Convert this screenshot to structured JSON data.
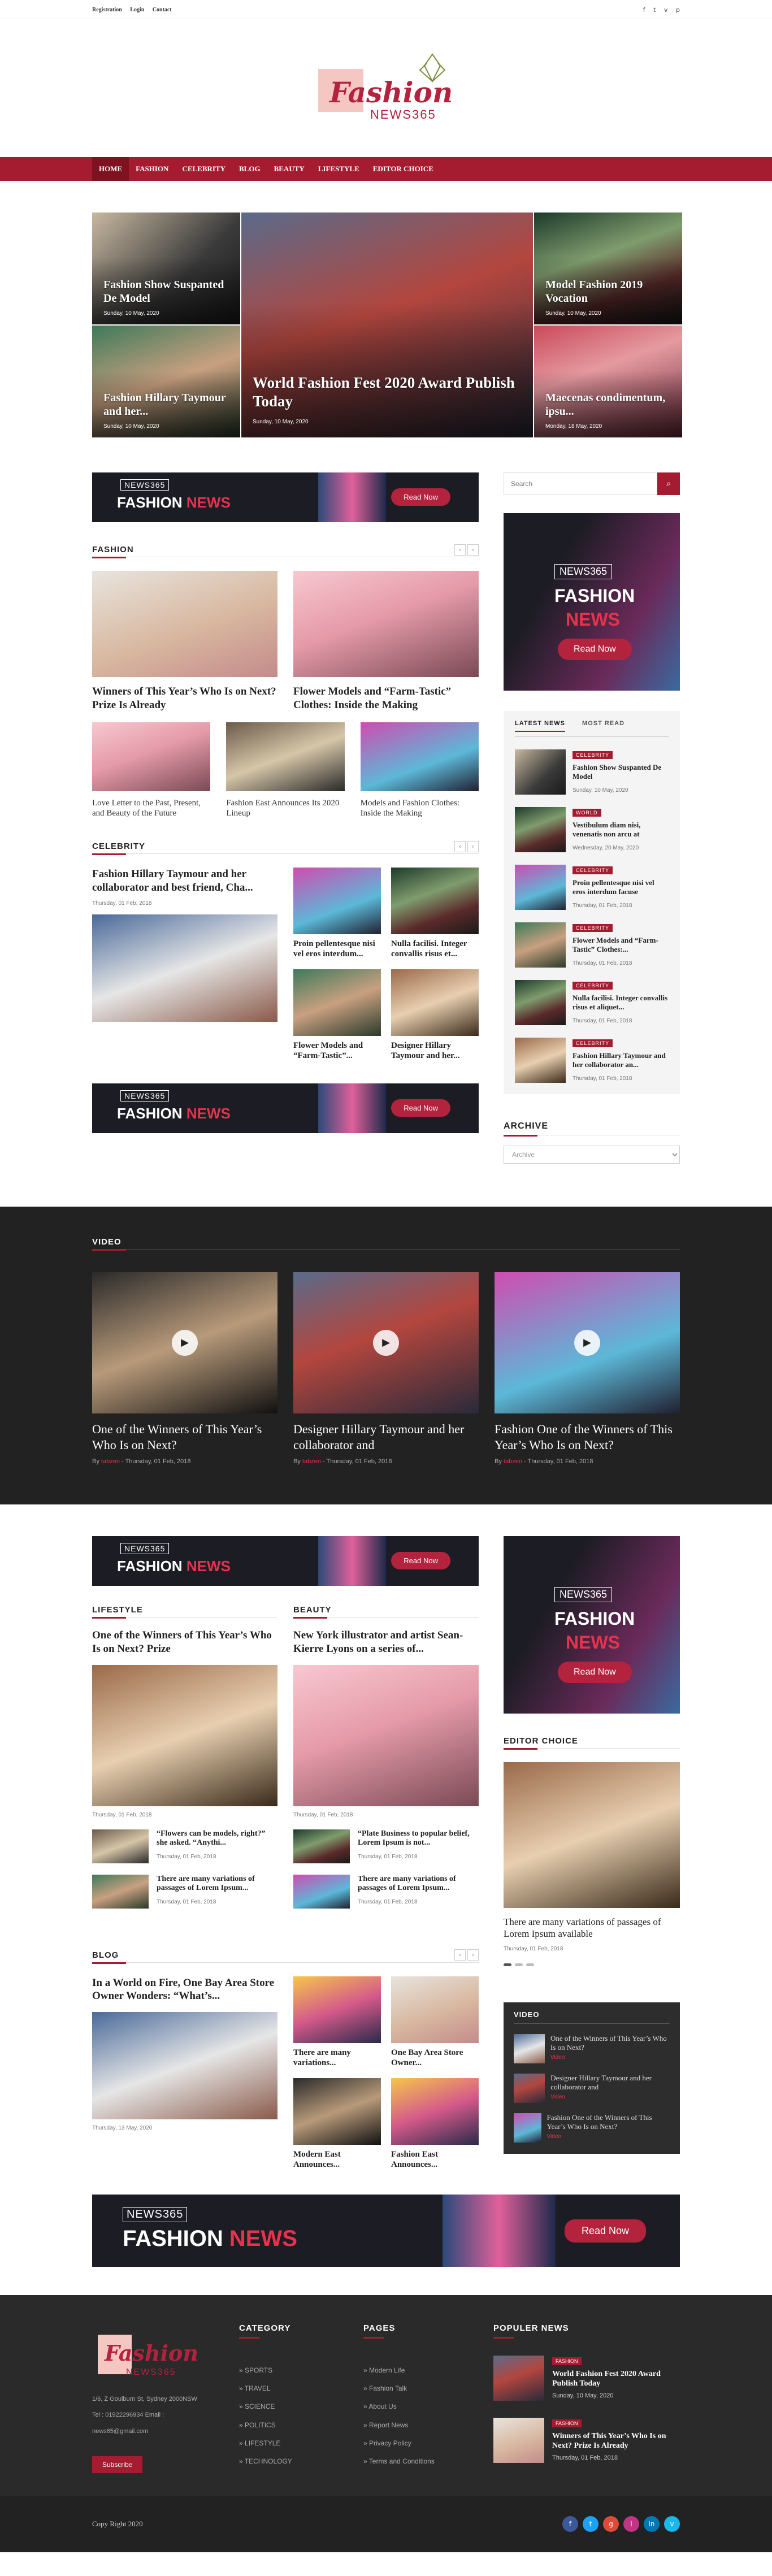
{
  "topbar": {
    "links": [
      "Registration",
      "Login",
      "Contact"
    ],
    "icons": [
      "f",
      "t",
      "v",
      "p"
    ]
  },
  "logo": {
    "word": "Fashion",
    "sub": "NEWS365"
  },
  "nav": [
    "HOME",
    "FASHION",
    "CELEBRITY",
    "BLOG",
    "BEAUTY",
    "LIFESTYLE",
    "EDITOR CHOICE"
  ],
  "hero": [
    {
      "title": "Fashion Show Suspanted De Model",
      "date": "Sunday, 10 May, 2020"
    },
    {
      "title": "World Fashion Fest 2020 Award Publish Today",
      "date": "Sunday, 10 May, 2020"
    },
    {
      "title": "Model Fashion 2019 Vocation",
      "date": "Sunday, 10 May, 2020"
    },
    {
      "title": "Fashion Hillary Taymour and her...",
      "date": "Sunday, 10 May, 2020"
    },
    {
      "title": "Maecenas condimentum, ipsu...",
      "date": "Monday, 18 May, 2020"
    }
  ],
  "banner": {
    "nb": "NEWS365",
    "fn1": "FASHION",
    "fn2": "NEWS",
    "btn": "Read Now"
  },
  "fashion": {
    "title": "FASHION",
    "main": [
      {
        "title": "Winners of This Year’s Who Is on Next? Prize Is Already"
      },
      {
        "title": "Flower Models and “Farm-Tastic” Clothes: Inside the Making"
      }
    ],
    "small": [
      {
        "title": "Love Letter to the Past, Present, and Beauty of the Future"
      },
      {
        "title": "Fashion East Announces Its 2020 Lineup"
      },
      {
        "title": "Models and Fashion Clothes: Inside the Making"
      }
    ]
  },
  "celebrity": {
    "title": "CELEBRITY",
    "main": {
      "title": "Fashion Hillary Taymour and her collaborator and best friend, Cha...",
      "date": "Thursday, 01 Feb, 2018"
    },
    "mini": [
      {
        "title": "Proin pellentesque nisi vel eros interdum..."
      },
      {
        "title": "Nulla facilisi. Integer convallis risus et..."
      },
      {
        "title": "Flower Models and “Farm-Tastic”..."
      },
      {
        "title": "Designer Hillary Taymour and her..."
      }
    ]
  },
  "sidebar": {
    "search_placeholder": "Search",
    "ad": {
      "nb": "NEWS365",
      "fn1": "FASHION",
      "fn2": "NEWS",
      "btn": "Read Now"
    },
    "tabs": [
      "LATEST NEWS",
      "MOST READ"
    ],
    "latest": [
      {
        "tag": "CELEBRITY",
        "title": "Fashion Show Suspanted De Model",
        "date": "Sunday, 10 May, 2020"
      },
      {
        "tag": "WORLD",
        "title": "Vestibulum diam nisi, venenatis non arcu at",
        "date": "Wednesday, 20 May, 2020"
      },
      {
        "tag": "CELEBRITY",
        "title": "Proin pellentesque nisi vel eros interdum facuse",
        "date": "Thursday, 01 Feb, 2018"
      },
      {
        "tag": "CELEBRITY",
        "title": "Flower Models and “Farm-Tastic” Clothes:...",
        "date": "Thursday, 01 Feb, 2018"
      },
      {
        "tag": "CELEBRITY",
        "title": "Nulla facilisi. Integer convallis risus et aliquet...",
        "date": "Thursday, 01 Feb, 2018"
      },
      {
        "tag": "CELEBRITY",
        "title": "Fashion Hillary Taymour and her collaborator an...",
        "date": "Thursday, 01 Feb, 2018"
      }
    ],
    "archive_title": "ARCHIVE",
    "archive_select": "Archive"
  },
  "video": {
    "title": "VIDEO",
    "items": [
      {
        "title": "One of the Winners of This Year’s Who Is on Next?",
        "by": "By",
        "author": "tabzen",
        "date": "- Thursday, 01 Feb, 2018"
      },
      {
        "title": "Designer Hillary Taymour and her collaborator and",
        "by": "By",
        "author": "tabzen",
        "date": "- Thursday, 01 Feb, 2018"
      },
      {
        "title": "Fashion One of the Winners of This Year’s Who Is on Next?",
        "by": "By",
        "author": "tabzen",
        "date": "- Thursday, 01 Feb, 2018"
      }
    ]
  },
  "lifestyle": {
    "title": "LIFESTYLE",
    "main": {
      "title": "One of the Winners of This Year’s Who Is on Next? Prize",
      "date": "Thursday, 01 Feb, 2018"
    },
    "items": [
      {
        "title": "“Flowers can be models, right?” she asked. “Anythi...",
        "date": "Thursday, 01 Feb, 2018"
      },
      {
        "title": "There are many variations of passages of Lorem Ipsum...",
        "date": "Thursday, 01 Feb, 2018"
      }
    ]
  },
  "beauty": {
    "title": "BEAUTY",
    "main": {
      "title": "New York illustrator and artist Sean-Kierre Lyons on a series of...",
      "date": "Thursday, 01 Feb, 2018"
    },
    "items": [
      {
        "title": "“Plate Business to popular belief, Lorem Ipsum is not...",
        "date": "Thursday, 01 Feb, 2018"
      },
      {
        "title": "There are many variations of passages of Lorem Ipsum...",
        "date": "Thursday, 01 Feb, 2018"
      }
    ]
  },
  "editor": {
    "title": "EDITOR CHOICE",
    "item": {
      "title": "There are many variations of passages of Lorem Ipsum available",
      "date": "Thursday, 01 Feb, 2018"
    }
  },
  "blog": {
    "title": "BLOG",
    "main": {
      "title": "In a World on Fire, One Bay Area Store Owner Wonders: “What’s...",
      "date": "Thursday, 13 May, 2020"
    },
    "mini": [
      {
        "title": "There are many variations..."
      },
      {
        "title": "One Bay Area Store Owner..."
      },
      {
        "title": "Modern East Announces..."
      },
      {
        "title": "Fashion East Announces..."
      }
    ]
  },
  "vside": {
    "title": "VIDEO",
    "items": [
      {
        "title": "One of the Winners of This Year’s Who Is on Next?",
        "tag": "Video"
      },
      {
        "title": "Designer Hillary Taymour and her collaborator and",
        "tag": "Video"
      },
      {
        "title": "Fashion One of the Winners of This Year’s Who Is on Next?",
        "tag": "Video"
      }
    ]
  },
  "footer": {
    "logo": {
      "word": "Fashion",
      "sub": "NEWS365"
    },
    "address": "1/6, Z Goulburn St, Sydney 2000NSW",
    "phone": "Tel : 01922296934 Email :",
    "email": "news65@gmail.com",
    "subscribe": "Subscribe",
    "category_title": "CATEGORY",
    "categories": [
      "SPORTS",
      "TRAVEL",
      "SCIENCE",
      "POLITICS",
      "LIFESTYLE",
      "TECHNOLOGY"
    ],
    "pages_title": "PAGES",
    "pages": [
      "Modern Life",
      "Fashion Talk",
      "About Us",
      "Report News",
      "Privacy Policy",
      "Terms and Conditions"
    ],
    "popular_title": "POPULER NEWS",
    "popular": [
      {
        "tag": "FASHION",
        "title": "World Fashion Fest 2020 Award Publish Today",
        "date": "Sunday, 10 May, 2020"
      },
      {
        "tag": "FASHION",
        "title": "Winners of This Year’s Who Is on Next? Prize Is Already",
        "date": "Thursday, 01 Feb, 2018"
      }
    ],
    "copyright": "Copy Right 2020",
    "social": [
      {
        "name": "facebook-icon",
        "glyph": "f",
        "color": "#3b5998"
      },
      {
        "name": "twitter-icon",
        "glyph": "t",
        "color": "#1da1f2"
      },
      {
        "name": "google-icon",
        "glyph": "g",
        "color": "#dd4b39"
      },
      {
        "name": "instagram-icon",
        "glyph": "i",
        "color": "#c13584"
      },
      {
        "name": "linkedin-icon",
        "glyph": "in",
        "color": "#0077b5"
      },
      {
        "name": "vimeo-icon",
        "glyph": "v",
        "color": "#1ab7ea"
      }
    ]
  }
}
